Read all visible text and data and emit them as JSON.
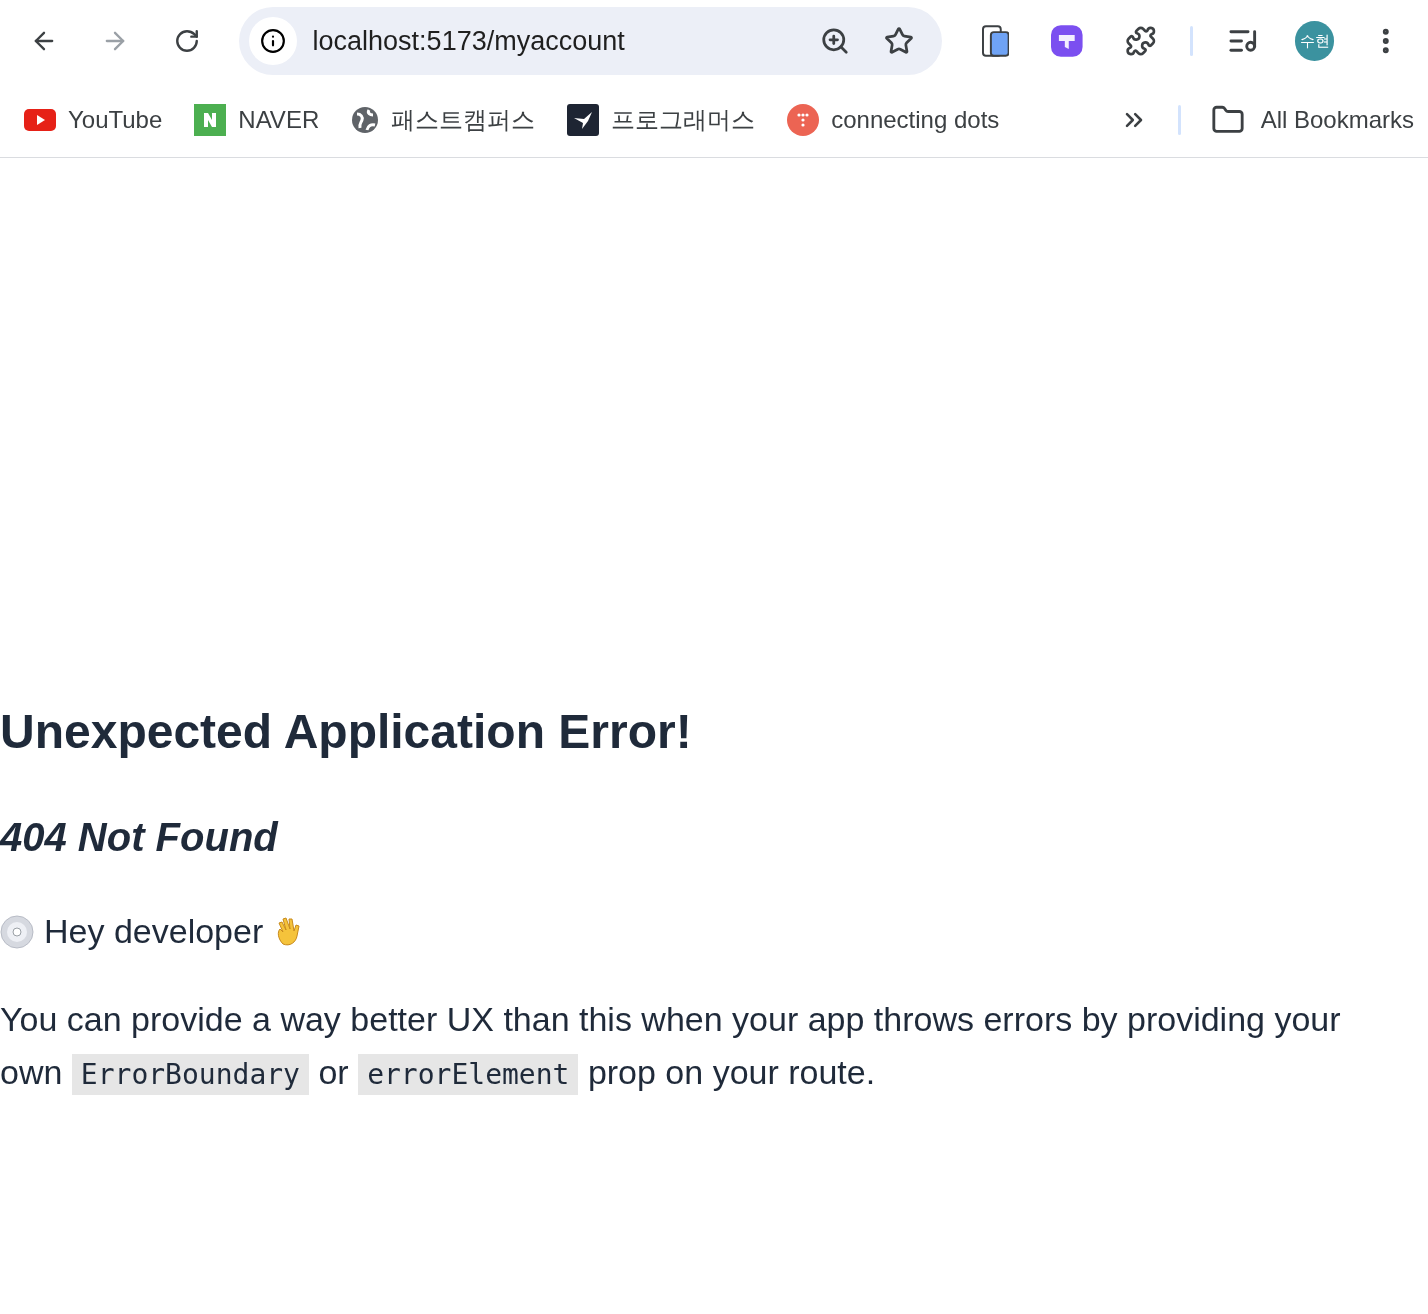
{
  "toolbar": {
    "url": "localhost:5173/myaccount",
    "forward_disabled": true,
    "profile_initials": "수현"
  },
  "bookmarks": [
    {
      "label": "YouTube",
      "kind": "youtube"
    },
    {
      "label": "NAVER",
      "kind": "naver"
    },
    {
      "label": "패스트캠퍼스",
      "kind": "globe"
    },
    {
      "label": "프로그래머스",
      "kind": "bird"
    },
    {
      "label": "connecting dots",
      "kind": "dots"
    }
  ],
  "all_bookmarks": "All Bookmarks",
  "page": {
    "title": "Unexpected Application Error!",
    "subtitle": "404 Not Found",
    "greeting": "Hey developer",
    "message": [
      {
        "kind": "text",
        "text": "You can provide a way better UX than this when your app throws errors by providing your own"
      },
      {
        "kind": "code",
        "text": "ErrorBoundary"
      },
      {
        "kind": "text",
        "text": "or"
      },
      {
        "kind": "code",
        "text": "errorElement"
      },
      {
        "kind": "text",
        "text": "prop on your route."
      }
    ]
  }
}
